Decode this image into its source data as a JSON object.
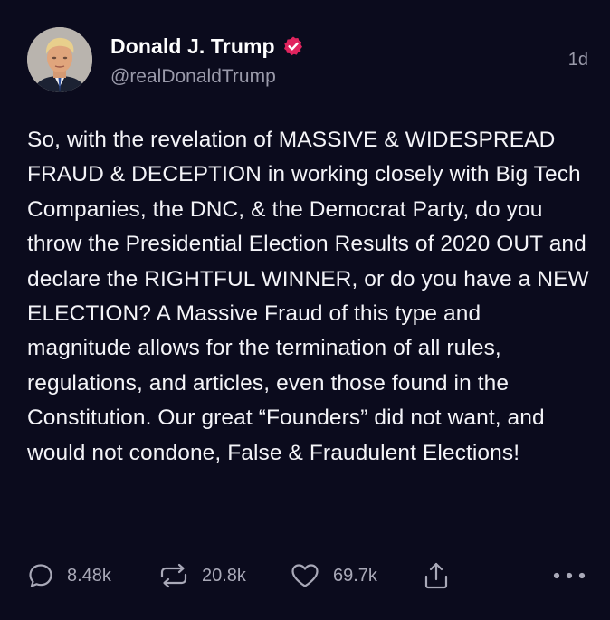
{
  "post": {
    "author": {
      "display_name": "Donald J. Trump",
      "handle": "@realDonaldTrump",
      "verified": true,
      "verified_color": "#e0245e"
    },
    "timestamp": "1d",
    "text": "So, with the revelation of MASSIVE & WIDESPREAD FRAUD & DECEPTION in working closely with Big Tech Companies, the DNC, & the Democrat Party, do you throw the Presidential Election Results of 2020 OUT and declare the RIGHTFUL WINNER, or do you have a NEW ELECTION? A Massive Fraud of this type and magnitude allows for the termination of all rules, regulations, and articles, even those found in the Constitution. Our great “Founders” did not want, and would not condone, False & Fraudulent Elections!",
    "actions": {
      "replies": "8.48k",
      "reposts": "20.8k",
      "likes": "69.7k"
    }
  },
  "icons": {
    "reply": "speech-bubble-icon",
    "repost": "repost-arrows-icon",
    "like": "heart-icon",
    "share": "share-upload-icon",
    "more": "more-dots-icon",
    "verified": "verified-badge-icon"
  },
  "colors": {
    "background": "#0b0b1d",
    "text": "#f4f4f8",
    "muted": "#9a9aaa"
  }
}
